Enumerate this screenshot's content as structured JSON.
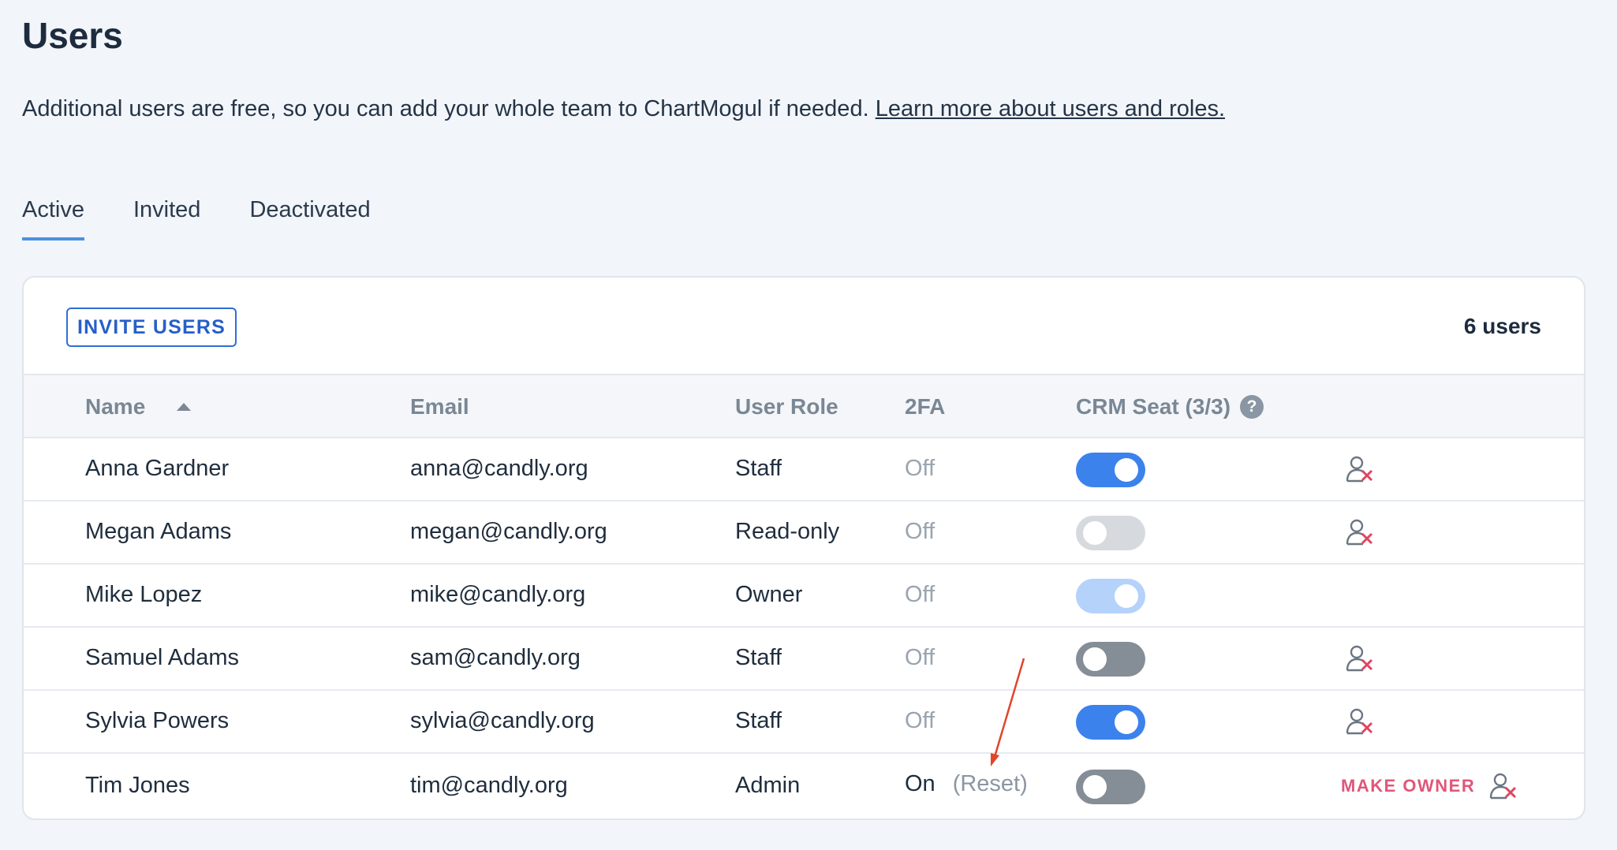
{
  "page": {
    "title": "Users",
    "description": "Additional users are free, so you can add your whole team to ChartMogul if needed. ",
    "learn_more_link": "Learn more about users and roles."
  },
  "tabs": [
    {
      "label": "Active",
      "active": true
    },
    {
      "label": "Invited",
      "active": false
    },
    {
      "label": "Deactivated",
      "active": false
    }
  ],
  "card": {
    "invite_button": "INVITE USERS",
    "user_count": "6 users"
  },
  "table": {
    "headers": {
      "name": "Name",
      "email": "Email",
      "role": "User Role",
      "twofa": "2FA",
      "crm_seat": "CRM Seat (3/3)",
      "help": "?"
    },
    "rows": [
      {
        "name": "Anna Gardner",
        "email": "anna@candly.org",
        "role": "Staff",
        "twofa": "Off",
        "crm_toggle": "on",
        "removable": true
      },
      {
        "name": "Megan Adams",
        "email": "megan@candly.org",
        "role": "Read-only",
        "twofa": "Off",
        "crm_toggle": "off-disabled",
        "removable": true
      },
      {
        "name": "Mike Lopez",
        "email": "mike@candly.org",
        "role": "Owner",
        "twofa": "Off",
        "crm_toggle": "on-disabled",
        "removable": false
      },
      {
        "name": "Samuel Adams",
        "email": "sam@candly.org",
        "role": "Staff",
        "twofa": "Off",
        "crm_toggle": "off",
        "removable": true
      },
      {
        "name": "Sylvia Powers",
        "email": "sylvia@candly.org",
        "role": "Staff",
        "twofa": "Off",
        "crm_toggle": "on",
        "removable": true
      },
      {
        "name": "Tim Jones",
        "email": "tim@candly.org",
        "role": "Admin",
        "twofa": "On",
        "twofa_reset": "(Reset)",
        "crm_toggle": "off",
        "make_owner": "MAKE OWNER",
        "removable": true
      }
    ]
  },
  "icons": {
    "remove_user": "remove-user-icon",
    "sort": "sort-ascending-icon"
  },
  "colors": {
    "accent": "#3b82ec",
    "danger": "#e0567a",
    "annotation_arrow": "#e0452b"
  }
}
